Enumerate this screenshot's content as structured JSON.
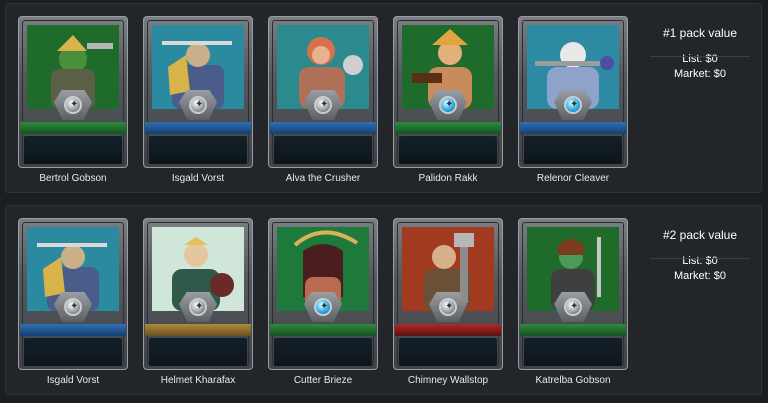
{
  "packs": [
    {
      "title": "#1 pack value",
      "list": "List: $0",
      "market": "Market: $0",
      "cards": [
        {
          "name": "Bertrol Gobson",
          "band": "#2f8a3d",
          "gem": "gray"
        },
        {
          "name": "Isgald Vorst",
          "band": "#2f6fb3",
          "gem": "gray"
        },
        {
          "name": "Alva the Crusher",
          "band": "#2f6fb3",
          "gem": "gray"
        },
        {
          "name": "Palidon Rakk",
          "band": "#2f8a3d",
          "gem": "blue"
        },
        {
          "name": "Relenor Cleaver",
          "band": "#2f6fb3",
          "gem": "blue"
        }
      ]
    },
    {
      "title": "#2 pack value",
      "list": "List: $0",
      "market": "Market: $0",
      "cards": [
        {
          "name": "Isgald Vorst",
          "band": "#2f6fb3",
          "gem": "gray"
        },
        {
          "name": "Helmet Kharafax",
          "band": "#b08a3a",
          "gem": "gray"
        },
        {
          "name": "Cutter Brieze",
          "band": "#2f8a3d",
          "gem": "blue"
        },
        {
          "name": "Chimney Wallstop",
          "band": "#b02a2a",
          "gem": "gray"
        },
        {
          "name": "Katrelba Gobson",
          "band": "#2f8a3d",
          "gem": "gray"
        }
      ]
    }
  ]
}
